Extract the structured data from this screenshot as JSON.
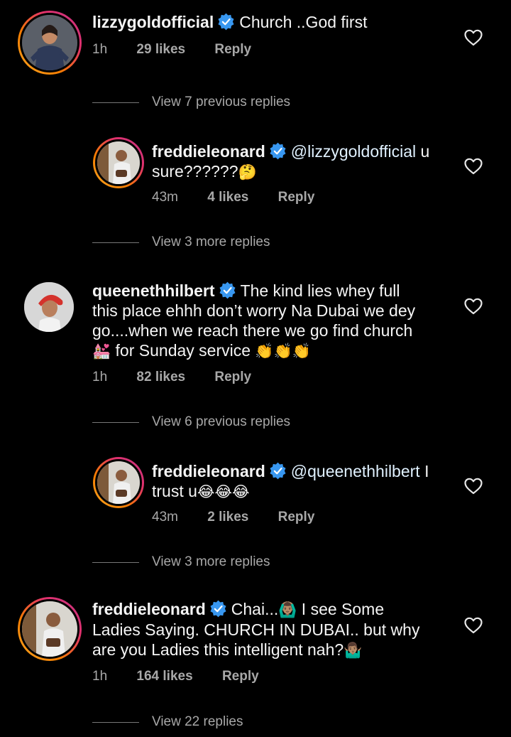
{
  "comments": [
    {
      "username": "lizzygoldofficial",
      "text": "Church ..God first",
      "time": "1h",
      "likes": "29 likes",
      "reply": "Reply",
      "view_more": "View 7 previous replies"
    },
    {
      "username": "freddieleonard",
      "mention": "@lizzygoldofficial",
      "text_line1": " u",
      "text_line2": "sure??????",
      "emoji": "🤔",
      "time": "43m",
      "likes": "4 likes",
      "reply": "Reply",
      "view_more": "View 3 more replies"
    },
    {
      "username": "queenethhilbert",
      "line1": "The kind lies whey full",
      "line2": "this place ehhh don’t worry Na Dubai we dey",
      "line3": "go....when we reach there we go find church",
      "line4_emoji": "💒",
      "line4": " for Sunday service ",
      "line4_end": "👏👏👏",
      "time": "1h",
      "likes": "82 likes",
      "reply": "Reply",
      "view_more": "View 6 previous replies"
    },
    {
      "username": "freddieleonard",
      "mention": "@queenethhilbert",
      "text_line1": " I",
      "text_line2": "trust u",
      "emoji": "😂😂😂",
      "time": "43m",
      "likes": "2 likes",
      "reply": "Reply",
      "view_more": "View 3 more replies"
    },
    {
      "username": "freddieleonard",
      "line1": "Chai...",
      "line1_emoji": "🙆🏽‍♂️",
      "line1_end": " I see Some",
      "line2": "Ladies Saying. CHURCH IN DUBAI.. but why",
      "line3": "are you Ladies this intelligent nah?",
      "line3_emoji": "🤷🏽‍♂️",
      "time": "1h",
      "likes": "164 likes",
      "reply": "Reply",
      "view_more": "View 22 replies"
    }
  ],
  "colors": {
    "verified": "#3897f0",
    "meta": "#a8a8a8",
    "text": "#f5f5f5"
  },
  "icons": [
    "verified-badge-icon",
    "heart-outline-icon"
  ]
}
